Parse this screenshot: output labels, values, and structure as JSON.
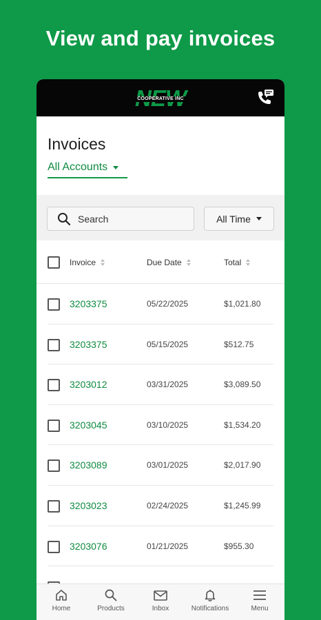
{
  "headline": "View and pay invoices",
  "topbar": {
    "logo_word": "NEW",
    "logo_sub": "COOPERATIVE INC",
    "contact_icon": "phone-chat-icon"
  },
  "page": {
    "title": "Invoices",
    "account_selector": "All Accounts"
  },
  "filters": {
    "search_label": "Search",
    "time_filter": "All Time"
  },
  "table": {
    "headers": {
      "invoice": "Invoice",
      "due_date": "Due Date",
      "total": "Total"
    },
    "rows": [
      {
        "invoice": "3203375",
        "due_date": "05/22/2025",
        "total": "$1,021.80"
      },
      {
        "invoice": "3203375",
        "due_date": "05/15/2025",
        "total": "$512.75"
      },
      {
        "invoice": "3203012",
        "due_date": "03/31/2025",
        "total": "$3,089.50"
      },
      {
        "invoice": "3203045",
        "due_date": "03/10/2025",
        "total": "$1,534.20"
      },
      {
        "invoice": "3203089",
        "due_date": "03/01/2025",
        "total": "$2,017.90"
      },
      {
        "invoice": "3203023",
        "due_date": "02/24/2025",
        "total": "$1,245.99"
      },
      {
        "invoice": "3203076",
        "due_date": "01/21/2025",
        "total": "$955.30"
      }
    ]
  },
  "nav": {
    "items": [
      {
        "label": "Home",
        "icon": "home-icon"
      },
      {
        "label": "Products",
        "icon": "search-icon"
      },
      {
        "label": "Inbox",
        "icon": "mail-icon"
      },
      {
        "label": "Notifications",
        "icon": "bell-icon"
      },
      {
        "label": "Menu",
        "icon": "menu-icon"
      }
    ]
  },
  "colors": {
    "brand_green": "#0e9a48",
    "link_green": "#0e8a40",
    "topbar_black": "#060606"
  }
}
